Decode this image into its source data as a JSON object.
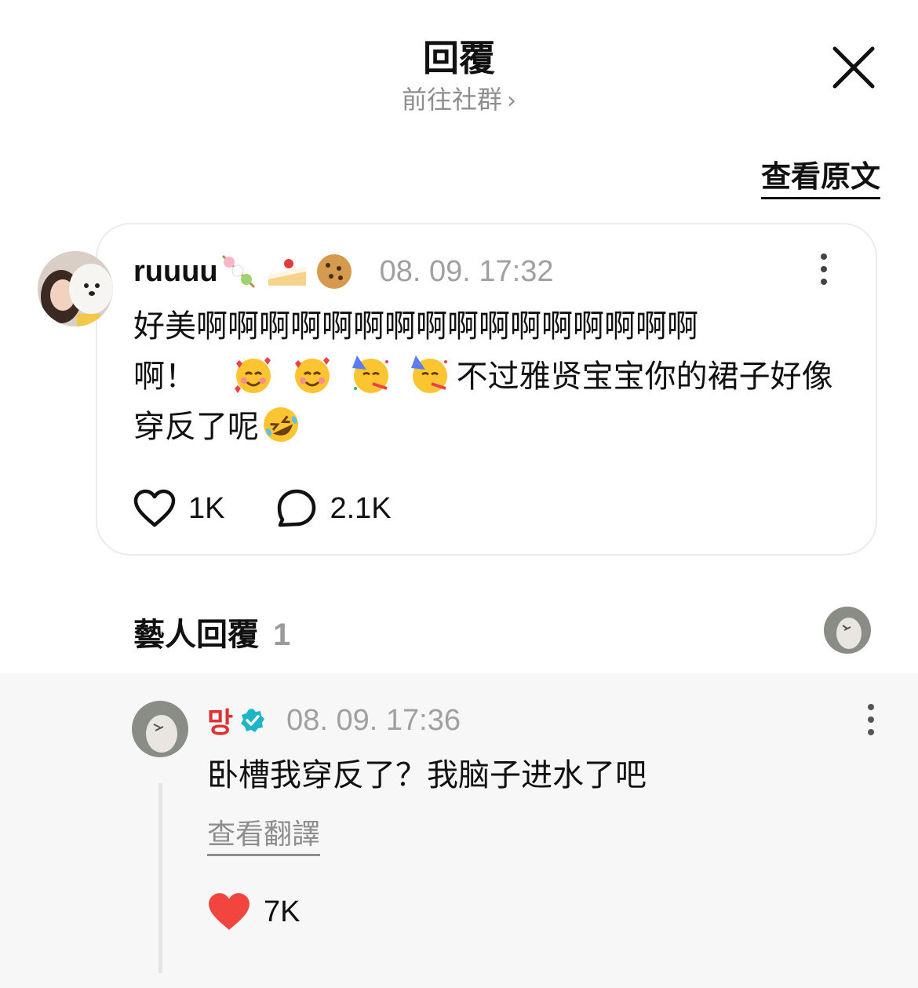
{
  "header": {
    "title": "回覆",
    "subtitle": "前往社群",
    "subtitle_chevron": "›",
    "view_original": "查看原文"
  },
  "icons": {
    "close": "close-icon",
    "more": "more-vertical-icon",
    "like": "heart-outline-icon",
    "comment": "speech-bubble-icon",
    "liked": "heart-filled-icon",
    "verified": "verified-badge-icon"
  },
  "colors": {
    "heart_filled": "#f2453d",
    "verified": "#1fb5c9",
    "artist_name": "#e03131"
  },
  "comment": {
    "username": "ruuuu",
    "username_emoji": [
      "dango-emoji",
      "shortcake-emoji",
      "cookie-emoji"
    ],
    "timestamp": "08. 09. 17:32",
    "text_line1": "好美啊啊啊啊啊啊啊啊啊啊啊啊啊啊啊啊",
    "text_line2_prefix": "啊！",
    "text_emoji": [
      "smiling-face-with-hearts-emoji",
      "smiling-face-with-hearts-emoji",
      "partying-face-emoji",
      "partying-face-emoji"
    ],
    "text_line2_suffix": "不过雅贤宝宝你的裙子好像",
    "text_line3": "穿反了呢",
    "text_trailing_emoji": "rolling-on-floor-laughing-emoji",
    "like_count": "1K",
    "reply_count": "2.1K"
  },
  "artist_replies": {
    "title": "藝人回覆",
    "count": "1"
  },
  "reply": {
    "username": "망",
    "timestamp": "08. 09. 17:36",
    "text": "卧槽我穿反了？我脑子进水了吧",
    "view_translation": "查看翻譯",
    "like_count": "7K"
  }
}
